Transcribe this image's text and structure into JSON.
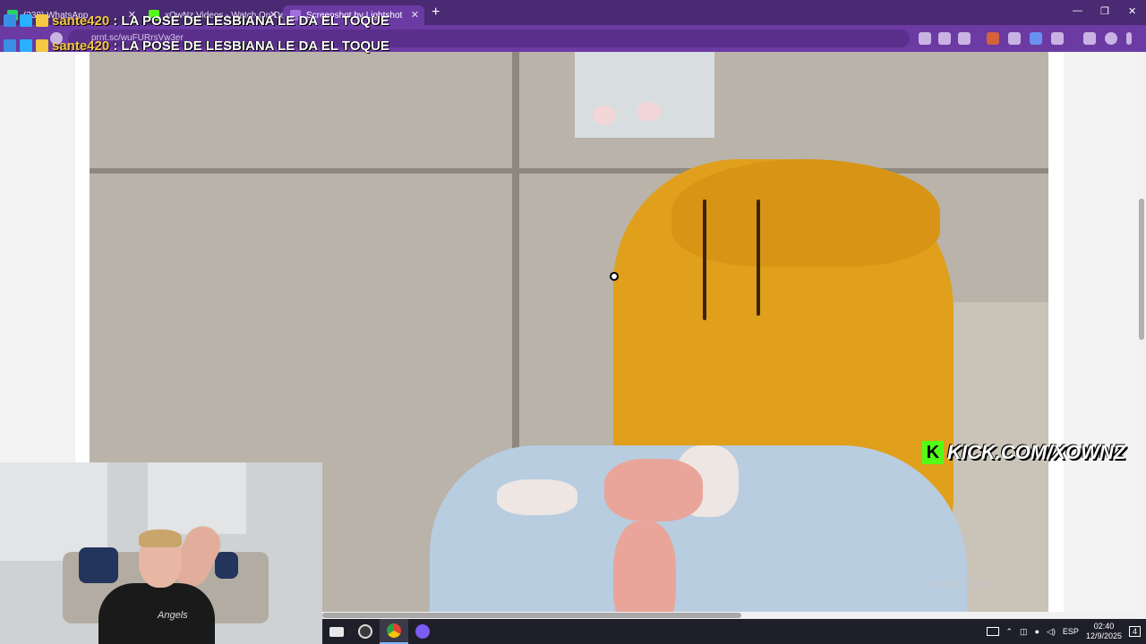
{
  "browser": {
    "tabs": [
      {
        "label": "(238) WhatsApp",
        "favicon_color": "#25d366",
        "active": false
      },
      {
        "label": "xOwNz Videos - Watch On-Dem",
        "favicon_color": "#53fc18",
        "active": false
      },
      {
        "label": "Screenshot by Lightshot",
        "favicon_color": "#a070e0",
        "active": true
      }
    ],
    "new_tab": "+",
    "close_glyph": "✕",
    "url": "prnt.sc/wuFURrsVw3er",
    "window_controls": [
      "—",
      "❐",
      "✕"
    ]
  },
  "chat": [
    {
      "user": "sante420",
      "message": ": LA POSE DE LESBIANA LE DA EL TOQUE"
    },
    {
      "user": "sante420",
      "message": ": LA POSE DE LESBIANA LE DA EL TOQUE"
    }
  ],
  "overlay": {
    "kick_logo": "K",
    "kick_url": "KICK.COM/XOWNZ",
    "activate_windows": "Activar Windows"
  },
  "webcam": {
    "shirt_text": "Angels"
  },
  "taskbar": {
    "language": "ESP",
    "time": "02:40",
    "date": "12/9/2025",
    "notifications": "4"
  },
  "colors": {
    "tabbar": "#4a2a72",
    "addressbar": "#6b3aa3",
    "chat_user": "#f4c842",
    "kick_green": "#53fc18"
  }
}
